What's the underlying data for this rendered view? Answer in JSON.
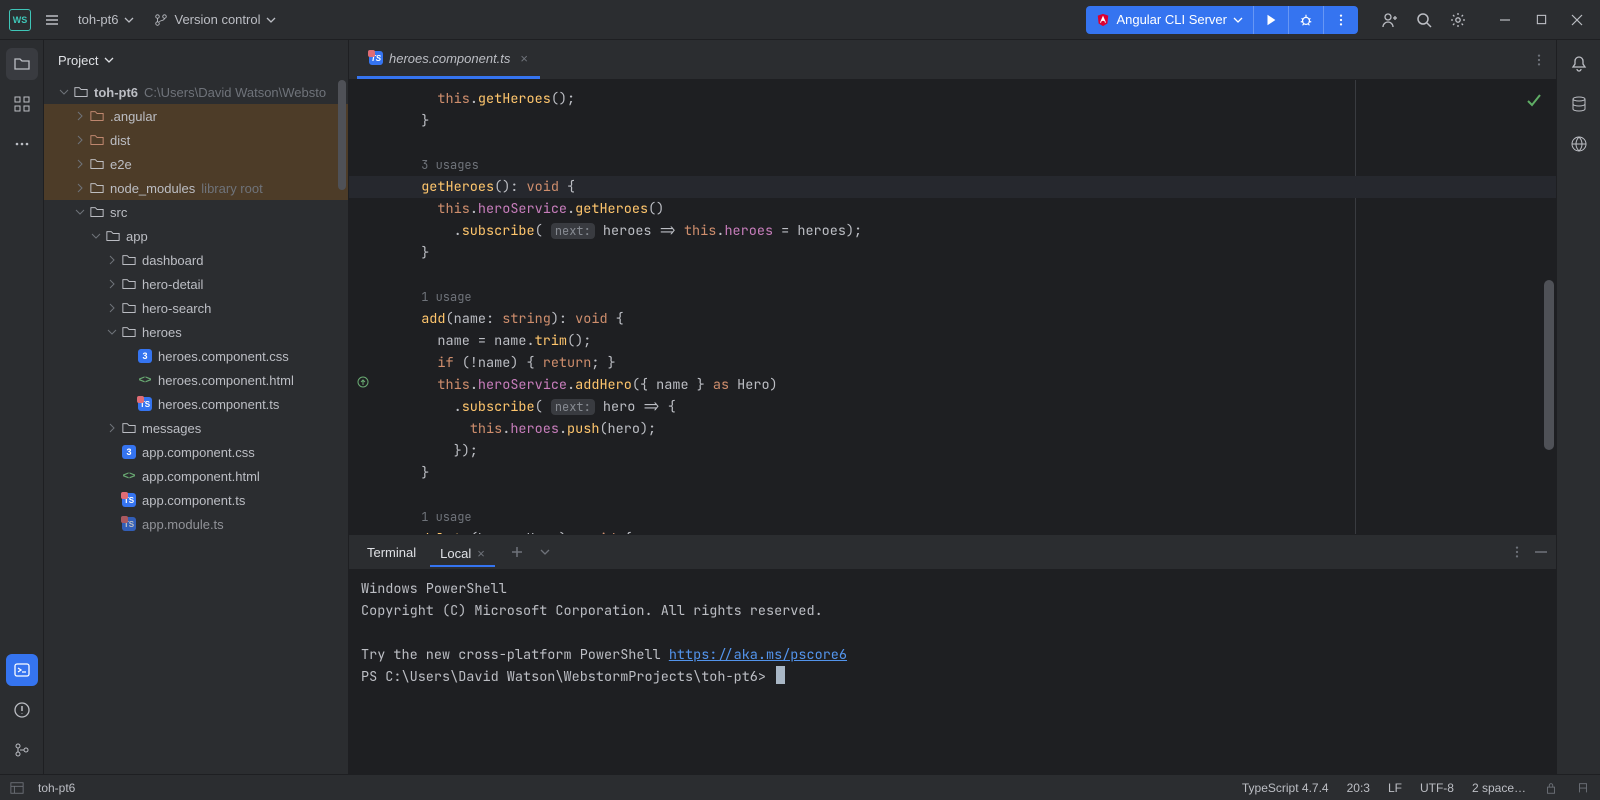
{
  "titlebar": {
    "project_name": "toh-pt6",
    "vcs_label": "Version control",
    "run_config": "Angular CLI Server"
  },
  "project": {
    "header": "Project",
    "root_name": "toh-pt6",
    "root_hint": "C:\\Users\\David Watson\\Websto",
    "folders": {
      "angular": ".angular",
      "dist": "dist",
      "e2e": "e2e",
      "node_modules": "node_modules",
      "node_modules_hint": "library root",
      "src": "src",
      "app": "app",
      "dashboard": "dashboard",
      "hero_detail": "hero-detail",
      "hero_search": "hero-search",
      "heroes": "heroes",
      "messages": "messages"
    },
    "files": {
      "heroes_css": "heroes.component.css",
      "heroes_html": "heroes.component.html",
      "heroes_ts": "heroes.component.ts",
      "app_css": "app.component.css",
      "app_html": "app.component.html",
      "app_ts": "app.component.ts",
      "app_module": "app.module.ts"
    }
  },
  "editor": {
    "tab": "heroes.component.ts",
    "usages3": "3 usages",
    "usages1a": "1 usage",
    "usages1b": "1 usage"
  },
  "terminal": {
    "tab_main": "Terminal",
    "tab_local": "Local",
    "line1": "Windows PowerShell",
    "line2": "Copyright (C) Microsoft Corporation. All rights reserved.",
    "line3_prefix": "Try the new cross-platform PowerShell ",
    "line3_link": "https://aka.ms/pscore6",
    "prompt": "PS C:\\Users\\David Watson\\WebstormProjects\\toh-pt6> "
  },
  "status": {
    "project": "toh-pt6",
    "ts": "TypeScript 4.7.4",
    "pos": "20:3",
    "le": "LF",
    "enc": "UTF-8",
    "indent": "2 space…"
  }
}
